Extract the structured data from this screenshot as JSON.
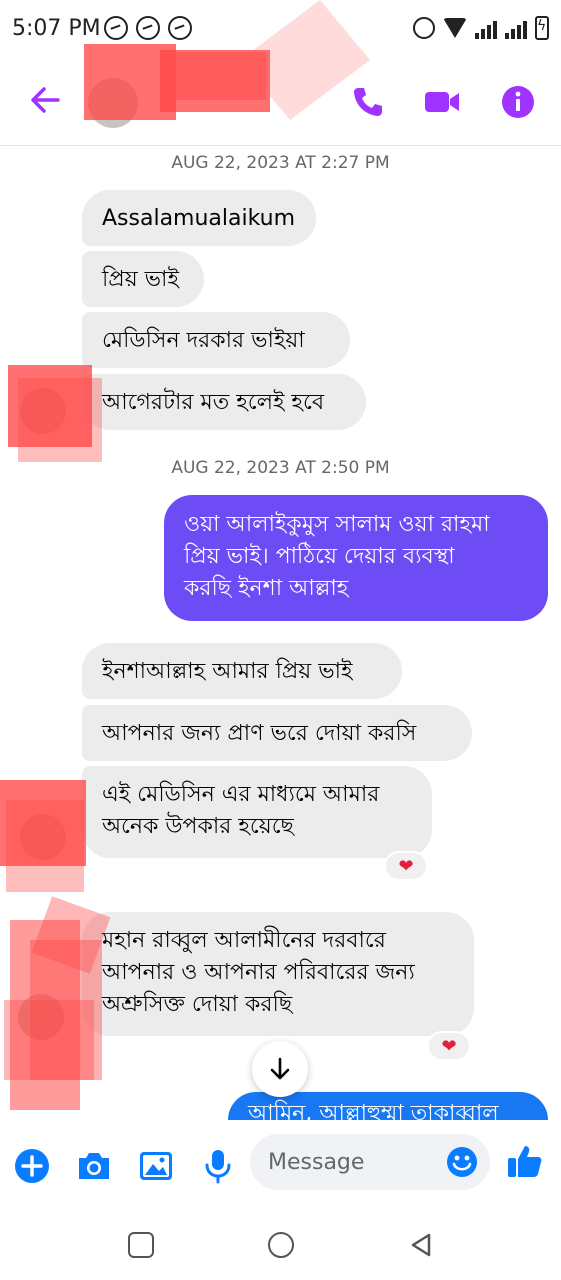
{
  "status_bar": {
    "time": "5:07 PM",
    "left_icons": [
      "messenger-icon",
      "messenger-icon",
      "whatsapp-icon"
    ],
    "right_icons": [
      "alarm-icon",
      "wifi-icon",
      "lte-signal-icon",
      "lte-signal-icon",
      "battery-charging-icon"
    ]
  },
  "header": {
    "back_icon": "back-arrow-icon",
    "call_icon": "phone-icon",
    "video_icon": "video-camera-icon",
    "info_icon": "info-icon",
    "accent_color": "#a033ff"
  },
  "conversation": {
    "timestamps": [
      "AUG 22, 2023 AT 2:27 PM",
      "AUG 22, 2023 AT 2:50 PM"
    ],
    "messages": [
      {
        "text": "Assalamualaikum"
      },
      {
        "text": "প্রিয় ভাই"
      },
      {
        "text": "মেডিসিন দরকার ভাইয়া"
      },
      {
        "text": "আগেরটার মত হলেই হবে"
      },
      {
        "text": "ওয়া আলাইকুমুস সালাম ওয়া রাহমা\nপ্রিয় ভাই। পাঠিয়ে দেয়ার ব্যবস্থা\nকরছি ইনশা আল্লাহ"
      },
      {
        "text": "ইনশাআল্লাহ আমার প্রিয় ভাই"
      },
      {
        "text": "আপনার জন্য প্রাণ ভরে দোয়া করসি"
      },
      {
        "text": "এই মেডিসিন এর মাধ্যমে আমার\nঅনেক উপকার হয়েছে"
      },
      {
        "text": "মহান রাব্বুল আলামীনের দরবারে\nআপনার ও আপনার পরিবারের জন্য\nঅশ্রুসিক্ত দোয়া করছি"
      },
      {
        "text": "আমিন, আল্লাহুম্মা তাকাব্বাল"
      }
    ],
    "reactions": [
      "❤",
      "❤"
    ],
    "colors": {
      "incoming": "#ececec",
      "outgoing": "#6d4cf6",
      "outgoing_latest": "#1877f2"
    }
  },
  "scroll_down_icon": "arrow-down-icon",
  "composer": {
    "placeholder": "Message",
    "icons": [
      "plus-icon",
      "camera-icon",
      "gallery-icon",
      "microphone-icon",
      "emoji-icon",
      "thumbs-up-icon"
    ],
    "accent_color": "#0a7cff"
  },
  "navbar": {
    "icons": [
      "recent-apps-icon",
      "home-icon",
      "back-icon"
    ]
  }
}
